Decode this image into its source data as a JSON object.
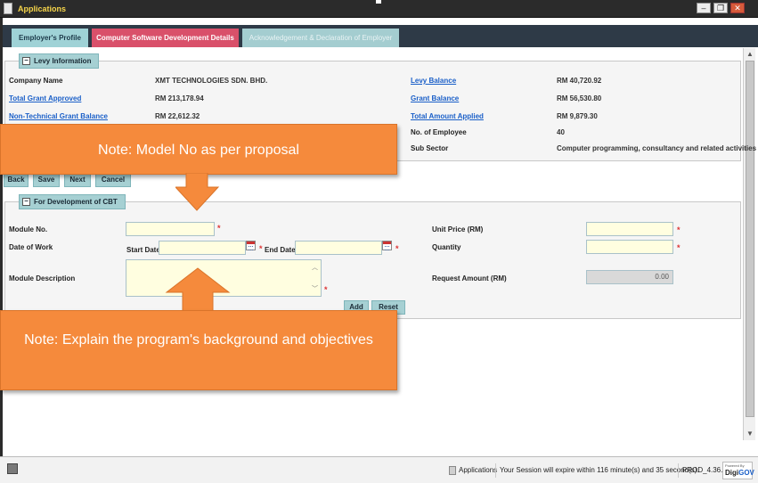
{
  "window": {
    "title": "Applications",
    "minimize_icon": "minimize-icon",
    "restore_icon": "restore-icon",
    "close_icon": "close-icon"
  },
  "tabs": [
    {
      "label": "Employer's Profile"
    },
    {
      "label": "Computer Software Development Details"
    },
    {
      "label": "Acknowledgement & Declaration of Employer"
    }
  ],
  "levy": {
    "legend": "Levy Information",
    "rows": [
      {
        "label": "Company Name",
        "value": "XMT TECHNOLOGIES SDN. BHD.",
        "label2": "Levy Balance",
        "value2": "RM 40,720.92"
      },
      {
        "label": "Total Grant Approved",
        "value": "RM 213,178.94",
        "label2": "Grant Balance",
        "value2": "RM 56,530.80"
      },
      {
        "label": "Non-Technical Grant Balance",
        "value": "RM 22,612.32",
        "label2": "Total Amount Applied",
        "value2": "RM 9,879.30"
      },
      {
        "label2": "No. of Employee",
        "value2": "40"
      },
      {
        "label2": "Sub Sector",
        "value2": "Computer programming, consultancy and related activities"
      }
    ]
  },
  "action_buttons": {
    "back": "Back",
    "save": "Save",
    "next": "Next",
    "cancel": "Cancel"
  },
  "cbt": {
    "legend": "For Development of CBT",
    "module_no_label": "Module No.",
    "date_of_work_label": "Date of Work",
    "start_date_label": "Start Date",
    "end_date_label": "End Date",
    "module_description_label": "Module Description",
    "unit_price_label": "Unit Price (RM)",
    "quantity_label": "Quantity",
    "request_amount_label": "Request Amount (RM)",
    "request_amount_value": "0.00",
    "required_mark": "*",
    "add_label": "Add",
    "reset_label": "Reset"
  },
  "callouts": {
    "top": "Note: Model No as per proposal",
    "bottom": "Note: Explain the program's background and objectives",
    "color": "#f58a3c"
  },
  "status": {
    "app": "Applications",
    "session": "Your Session will expire within 116 minute(s) and 35 second(s).",
    "version": "PROD_4.36.0",
    "logo_small": "Powered By",
    "logo_main_a": "Digi",
    "logo_main_b": "GOV"
  },
  "colors": {
    "tab_active": "#d9506a",
    "tab_inactive": "#9fd2d6",
    "link": "#1a5fc8",
    "input_bg": "#fffee0",
    "required": "#dd3333"
  }
}
